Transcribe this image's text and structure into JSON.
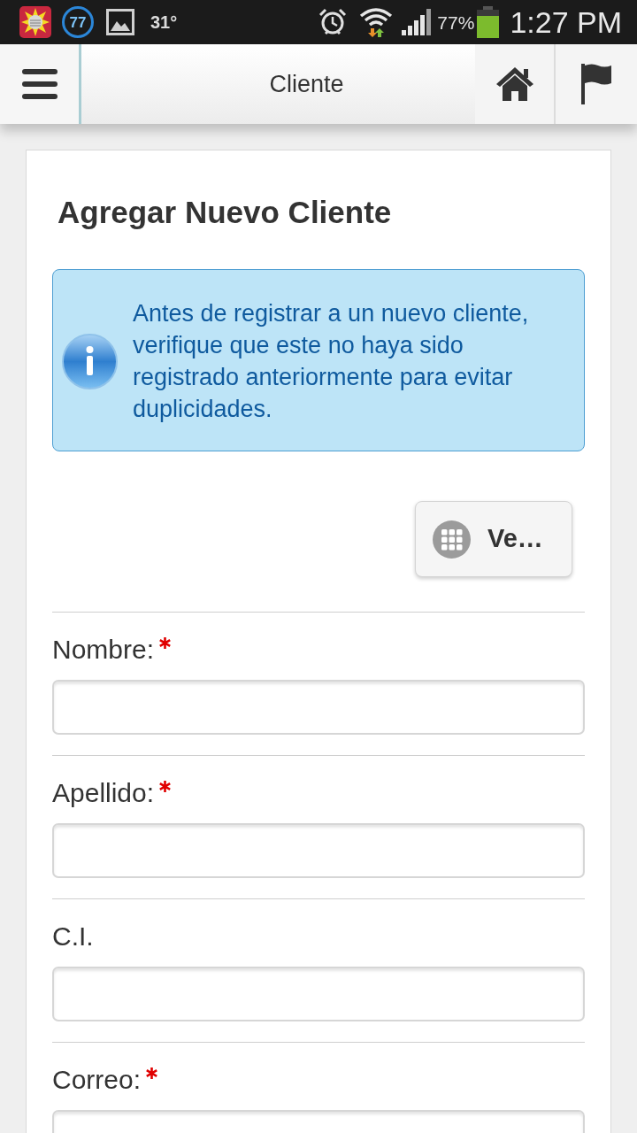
{
  "status_bar": {
    "badge_count": "77",
    "temperature": "31°",
    "battery_percent": "77%",
    "time": "1:27 PM"
  },
  "header": {
    "title": "Cliente"
  },
  "form": {
    "title": "Agregar Nuevo Cliente",
    "info_message": "Antes de registrar a un nuevo cliente, verifique que este no haya sido registrado anteriormente para evitar duplicidades.",
    "action_button": {
      "label": "Ve…"
    },
    "fields": [
      {
        "label": "Nombre:",
        "required": true
      },
      {
        "label": "Apellido:",
        "required": true
      },
      {
        "label": "C.I.",
        "required": false
      },
      {
        "label": "Correo:",
        "required": true
      }
    ]
  }
}
